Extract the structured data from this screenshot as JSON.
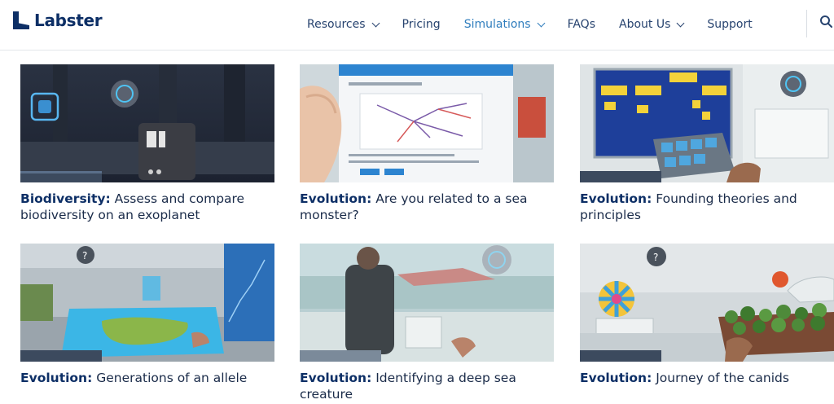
{
  "brand": {
    "name": "Labster"
  },
  "nav": {
    "items": [
      {
        "label": "Resources",
        "dropdown": true
      },
      {
        "label": "Pricing",
        "dropdown": false
      },
      {
        "label": "Simulations",
        "dropdown": true,
        "active": true
      },
      {
        "label": "FAQs",
        "dropdown": false
      },
      {
        "label": "About Us",
        "dropdown": true
      },
      {
        "label": "Support",
        "dropdown": false
      }
    ]
  },
  "colors": {
    "brand": "#0d2f66",
    "nav_text": "#27436f",
    "nav_active": "#2f7dbd"
  },
  "cards": [
    {
      "category": "Biodiversity:",
      "title": " Assess and compare biodiversity on an exoplanet"
    },
    {
      "category": "Evolution:",
      "title": " Are you related to a sea monster?"
    },
    {
      "category": "Evolution:",
      "title": " Founding theories and principles"
    },
    {
      "category": "Evolution:",
      "title": " Generations of an allele"
    },
    {
      "category": "Evolution:",
      "title": " Identifying a deep sea creature"
    },
    {
      "category": "Evolution:",
      "title": " Journey of the canids"
    }
  ]
}
